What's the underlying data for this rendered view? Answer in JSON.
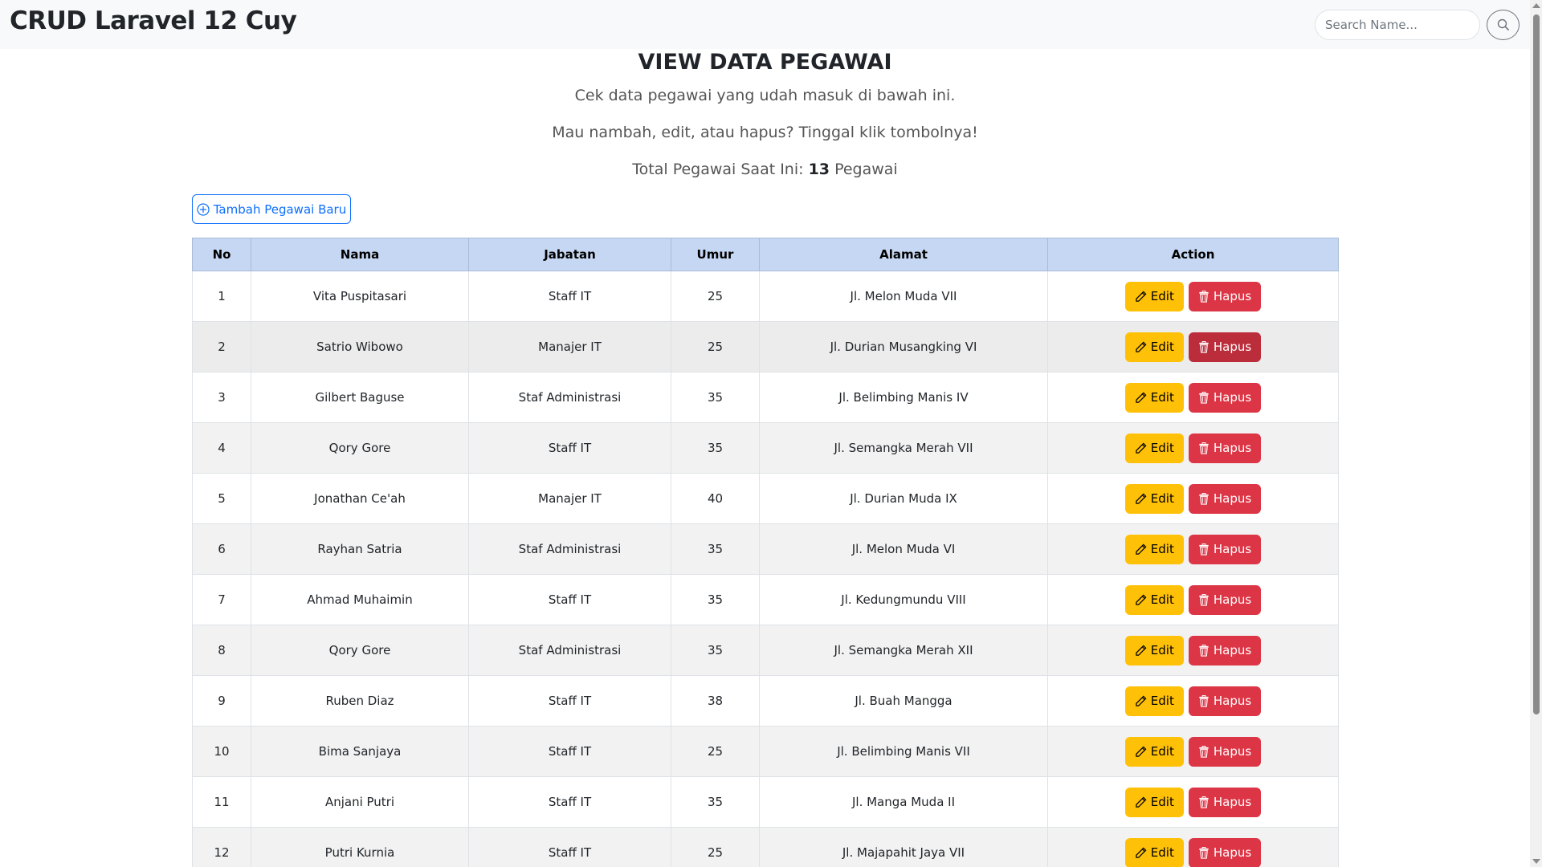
{
  "navbar": {
    "brand": "CRUD Laravel 12 Cuy",
    "search_placeholder": "Search Name...",
    "search_icon": "search-icon"
  },
  "main": {
    "title": "VIEW DATA PEGAWAI",
    "subtitle1": "Cek data pegawai yang udah masuk di bawah ini.",
    "subtitle2": "Mau nambah, edit, atau hapus? Tinggal klik tombolnya!",
    "total_prefix": "Total Pegawai Saat Ini: ",
    "total_count": "13",
    "total_suffix": " Pegawai",
    "add_button": "Tambah Pegawai Baru"
  },
  "table": {
    "headers": [
      "No",
      "Nama",
      "Jabatan",
      "Umur",
      "Alamat",
      "Action"
    ],
    "edit_label": "Edit",
    "delete_label": "Hapus",
    "rows": [
      [
        "1",
        "Vita Puspitasari",
        "Staff IT",
        "25",
        "Jl. Melon Muda VII"
      ],
      [
        "2",
        "Satrio Wibowo",
        "Manajer IT",
        "25",
        "Jl. Durian Musangking VI"
      ],
      [
        "3",
        "Gilbert Baguse",
        "Staf Administrasi",
        "35",
        "Jl. Belimbing Manis IV"
      ],
      [
        "4",
        "Qory Gore",
        "Staff IT",
        "35",
        "Jl. Semangka Merah VII"
      ],
      [
        "5",
        "Jonathan Ce'ah",
        "Manajer IT",
        "40",
        "Jl. Durian Muda IX"
      ],
      [
        "6",
        "Rayhan Satria",
        "Staf Administrasi",
        "35",
        "Jl. Melon Muda VI"
      ],
      [
        "7",
        "Ahmad Muhaimin",
        "Staff IT",
        "35",
        "Jl. Kedungmundu VIII"
      ],
      [
        "8",
        "Qory Gore",
        "Staf Administrasi",
        "35",
        "Jl. Semangka Merah XII"
      ],
      [
        "9",
        "Ruben Diaz",
        "Staff IT",
        "38",
        "Jl. Buah Mangga"
      ],
      [
        "10",
        "Bima Sanjaya",
        "Staff IT",
        "25",
        "Jl. Belimbing Manis VII"
      ],
      [
        "11",
        "Anjani Putri",
        "Staff IT",
        "35",
        "Jl. Manga Muda II"
      ],
      [
        "12",
        "Putri Kurnia",
        "Staff IT",
        "25",
        "Jl. Majapahit Jaya VII"
      ]
    ]
  },
  "colors": {
    "primary": "#0d6efd",
    "warning": "#ffc107",
    "danger": "#dc3545",
    "header_bg": "#c5d7f2"
  }
}
